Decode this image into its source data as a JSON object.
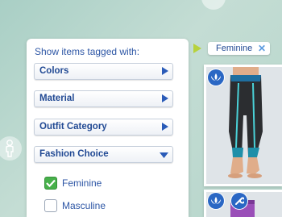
{
  "filter_panel": {
    "title": "Show items tagged with:",
    "categories": [
      {
        "label": "Colors",
        "expanded": false
      },
      {
        "label": "Material",
        "expanded": false
      },
      {
        "label": "Outfit Category",
        "expanded": false
      },
      {
        "label": "Fashion Choice",
        "expanded": true
      }
    ],
    "options": [
      {
        "label": "Feminine",
        "checked": true
      },
      {
        "label": "Masculine",
        "checked": false
      }
    ]
  },
  "active_tags": [
    {
      "label": "Feminine",
      "remove_symbol": "✕"
    }
  ],
  "items": [
    {
      "badge_icon": "lotus-icon"
    },
    {
      "badge_icons": [
        "lotus-icon",
        "wrench-icon"
      ]
    }
  ],
  "colors": {
    "accent": "#2d56a5",
    "check_green": "#47b04a",
    "badge_blue": "#2a67c4"
  }
}
